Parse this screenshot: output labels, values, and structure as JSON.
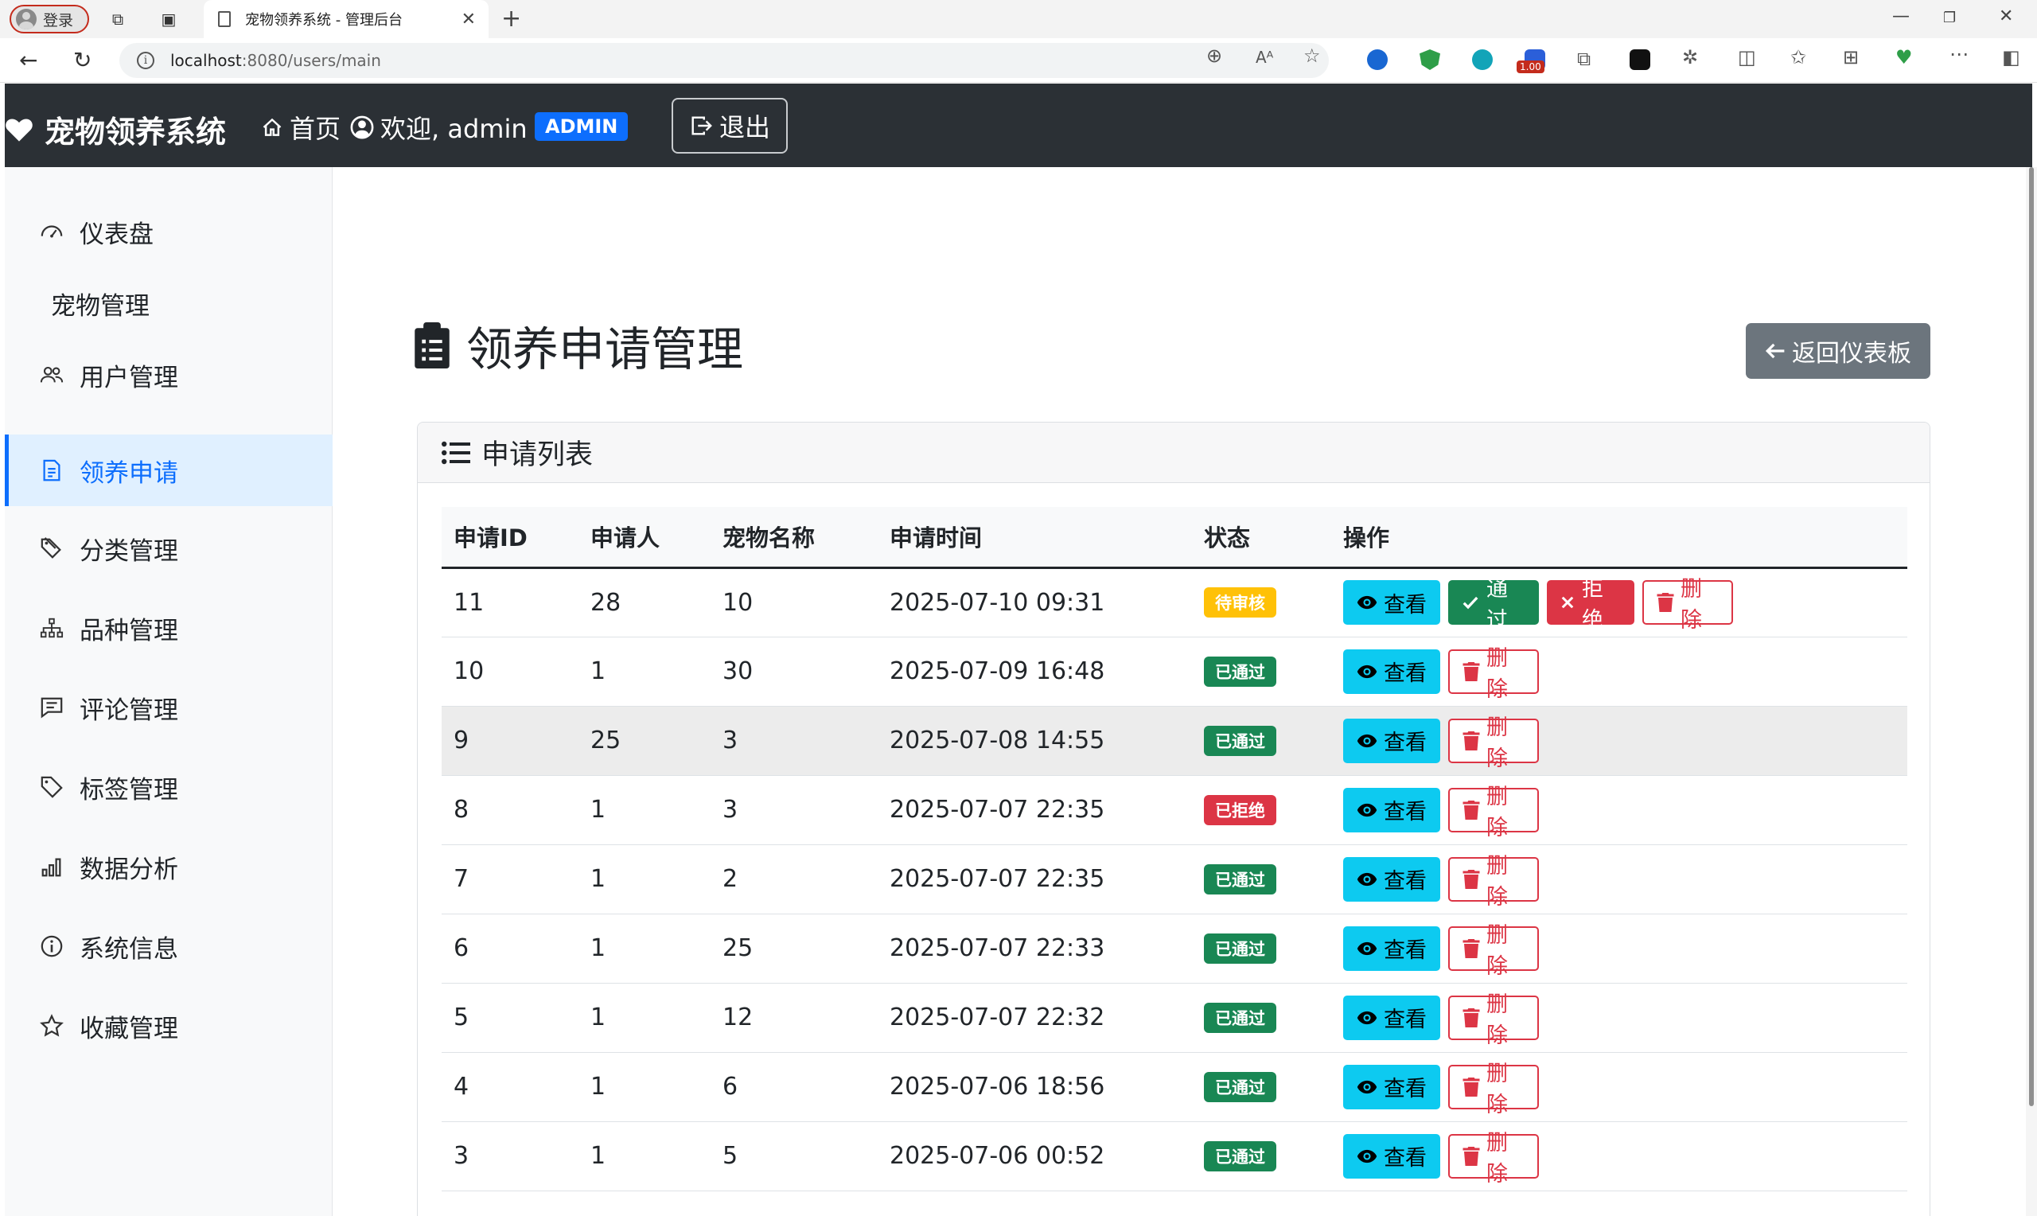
{
  "browser": {
    "profile_label": "登录",
    "tab_title": "宠物领养系统 - 管理后台",
    "url_host": "localhost",
    "url_rest": ":8080/users/main",
    "ext_badge": "1.00"
  },
  "navbar": {
    "brand": "宠物领养系统",
    "home": "首页",
    "welcome": "欢迎, admin",
    "role_badge": "ADMIN",
    "logout": "退出"
  },
  "sidebar": {
    "items": [
      {
        "label": "仪表盘",
        "icon": "speedometer-icon"
      },
      {
        "label": "宠物管理",
        "icon": ""
      },
      {
        "label": "用户管理",
        "icon": "people-icon"
      },
      {
        "label": "领养申请",
        "icon": "document-icon",
        "active": true
      },
      {
        "label": "分类管理",
        "icon": "tags-icon"
      },
      {
        "label": "品种管理",
        "icon": "diagram-icon"
      },
      {
        "label": "评论管理",
        "icon": "chat-icon"
      },
      {
        "label": "标签管理",
        "icon": "tag-icon"
      },
      {
        "label": "数据分析",
        "icon": "bar-chart-icon"
      },
      {
        "label": "系统信息",
        "icon": "info-icon"
      },
      {
        "label": "收藏管理",
        "icon": "star-icon"
      }
    ]
  },
  "main": {
    "title": "领养申请管理",
    "back_button": "返回仪表板",
    "card_title": "申请列表",
    "columns": [
      "申请ID",
      "申请人",
      "宠物名称",
      "申请时间",
      "状态",
      "操作"
    ],
    "actions": {
      "view": "查看",
      "approve": "通过",
      "reject": "拒绝",
      "delete": "删除"
    },
    "rows": [
      {
        "id": "11",
        "applicant": "28",
        "pet": "10",
        "time": "2025-07-10 09:31",
        "status": "待审核",
        "status_type": "pending"
      },
      {
        "id": "10",
        "applicant": "1",
        "pet": "30",
        "time": "2025-07-09 16:48",
        "status": "已通过",
        "status_type": "approved"
      },
      {
        "id": "9",
        "applicant": "25",
        "pet": "3",
        "time": "2025-07-08 14:55",
        "status": "已通过",
        "status_type": "approved"
      },
      {
        "id": "8",
        "applicant": "1",
        "pet": "3",
        "time": "2025-07-07 22:35",
        "status": "已拒绝",
        "status_type": "rejected"
      },
      {
        "id": "7",
        "applicant": "1",
        "pet": "2",
        "time": "2025-07-07 22:35",
        "status": "已通过",
        "status_type": "approved"
      },
      {
        "id": "6",
        "applicant": "1",
        "pet": "25",
        "time": "2025-07-07 22:33",
        "status": "已通过",
        "status_type": "approved"
      },
      {
        "id": "5",
        "applicant": "1",
        "pet": "12",
        "time": "2025-07-07 22:32",
        "status": "已通过",
        "status_type": "approved"
      },
      {
        "id": "4",
        "applicant": "1",
        "pet": "6",
        "time": "2025-07-06 18:56",
        "status": "已通过",
        "status_type": "approved"
      },
      {
        "id": "3",
        "applicant": "1",
        "pet": "5",
        "time": "2025-07-06 00:52",
        "status": "已通过",
        "status_type": "approved"
      }
    ]
  },
  "colors": {
    "navbar": "#2b3035",
    "primary": "#0d6efd",
    "info": "#0dcaf0",
    "success": "#198754",
    "danger": "#dc3545",
    "warning": "#ffc107",
    "secondary": "#6c757d"
  }
}
